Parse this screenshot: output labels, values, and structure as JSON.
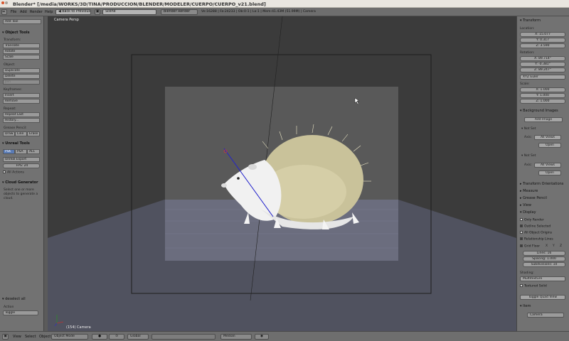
{
  "window": {
    "title": "Blender* [/media/WORKS/3D/TINA/PRODUCCION/BLENDER/MODELER/CUERPO/CUERPO_v21.blend]"
  },
  "menubar": {
    "menu_items": [
      "File",
      "Add",
      "Render",
      "Help"
    ],
    "back_button": "Back to Previous",
    "scene": "Scene",
    "render_engine": "Blender Render",
    "stats": "Ve:16288 | Fa:24233 | Ob:0-1 | La:1 | Mem:41.43M (51.99M) | Camera"
  },
  "left_panel": {
    "add_tool": "Add Tool",
    "object_tools": "Object Tools",
    "transform_label": "Transform:",
    "transform_buttons": [
      "Translate",
      "Rotate",
      "Scale"
    ],
    "object_label": "Object:",
    "object_buttons": [
      "Duplicate",
      "Delete",
      "Join"
    ],
    "keyframes_label": "Keyframes:",
    "keyframe_buttons": [
      "Insert",
      "Remove"
    ],
    "repeat_label": "Repeat:",
    "repeat_buttons": [
      "Repeat Last",
      "History..."
    ],
    "grease_label": "Grease Pencil:",
    "grease_buttons": [
      "Draw",
      "Line",
      "Erase"
    ],
    "unreal_tools": "Unreal Tools",
    "unreal_buttons": [
      "PSK",
      "PSA",
      "ALL"
    ],
    "unreal_export": "Unreal Export",
    "fps": "FPS: 24",
    "all_actions": "All Actions",
    "cloud_generator": "Cloud Generator",
    "cloud_text": "Select one or more objects to generate a cloud.",
    "deselect_all": "deselect all",
    "action_label": "Action",
    "action_value": "Toggle"
  },
  "viewport": {
    "label": "Camera Persp",
    "status": "(154) Camera",
    "colors": {
      "bg": "#3b3b3b",
      "frame": "#595959",
      "ground": "#6b6d7e",
      "hair": "#c9c29a",
      "cursor_line": "#2222cc"
    }
  },
  "right_panel": {
    "transform": "Transform",
    "location_label": "Location:",
    "location": [
      "X: 15.077",
      "Y: 0.317",
      "Z: 3.590"
    ],
    "rotation_label": "Rotation:",
    "rotation": [
      "X: 89.714°",
      "Y: -0.381°",
      "Z: 89.247°"
    ],
    "rotation_mode": "XYZ Euler",
    "scale_label": "Scale:",
    "scale": [
      "X: 1.000",
      "Y: 1.000",
      "Z: 1.000"
    ],
    "background_images": "Background Images",
    "add_image": "Add Image",
    "not_set": "Not Set",
    "axis_label": "Axis:",
    "all_views": "All Views",
    "open": "Open",
    "transform_orientations": "Transform Orientations",
    "measure": "Measure",
    "grease_pencil": "Grease Pencil",
    "view": "View",
    "display": "Display",
    "only_render": "Only Render",
    "outline_selected": "Outline Selected",
    "all_object_origins": "All Object Origins",
    "relationship_lines": "Relationship Lines",
    "grid_floor": "Grid Floor",
    "grid_axes": [
      "X",
      "Y",
      "Z"
    ],
    "lines": "Lines: 16",
    "spacing": "Spacing: 1.000",
    "subdivisions": "Subdivisions: 10",
    "shading_label": "Shading:",
    "shading": "Multitexture",
    "textured_solid": "Textured Solid",
    "toggle_quad_view": "Toggle Quad View",
    "item": "Item",
    "item_name": "Camera"
  },
  "bottombar": {
    "menus": [
      "View",
      "Select",
      "Object"
    ],
    "mode": "Object Mode",
    "orientation": "Global",
    "pivot": "Median"
  }
}
